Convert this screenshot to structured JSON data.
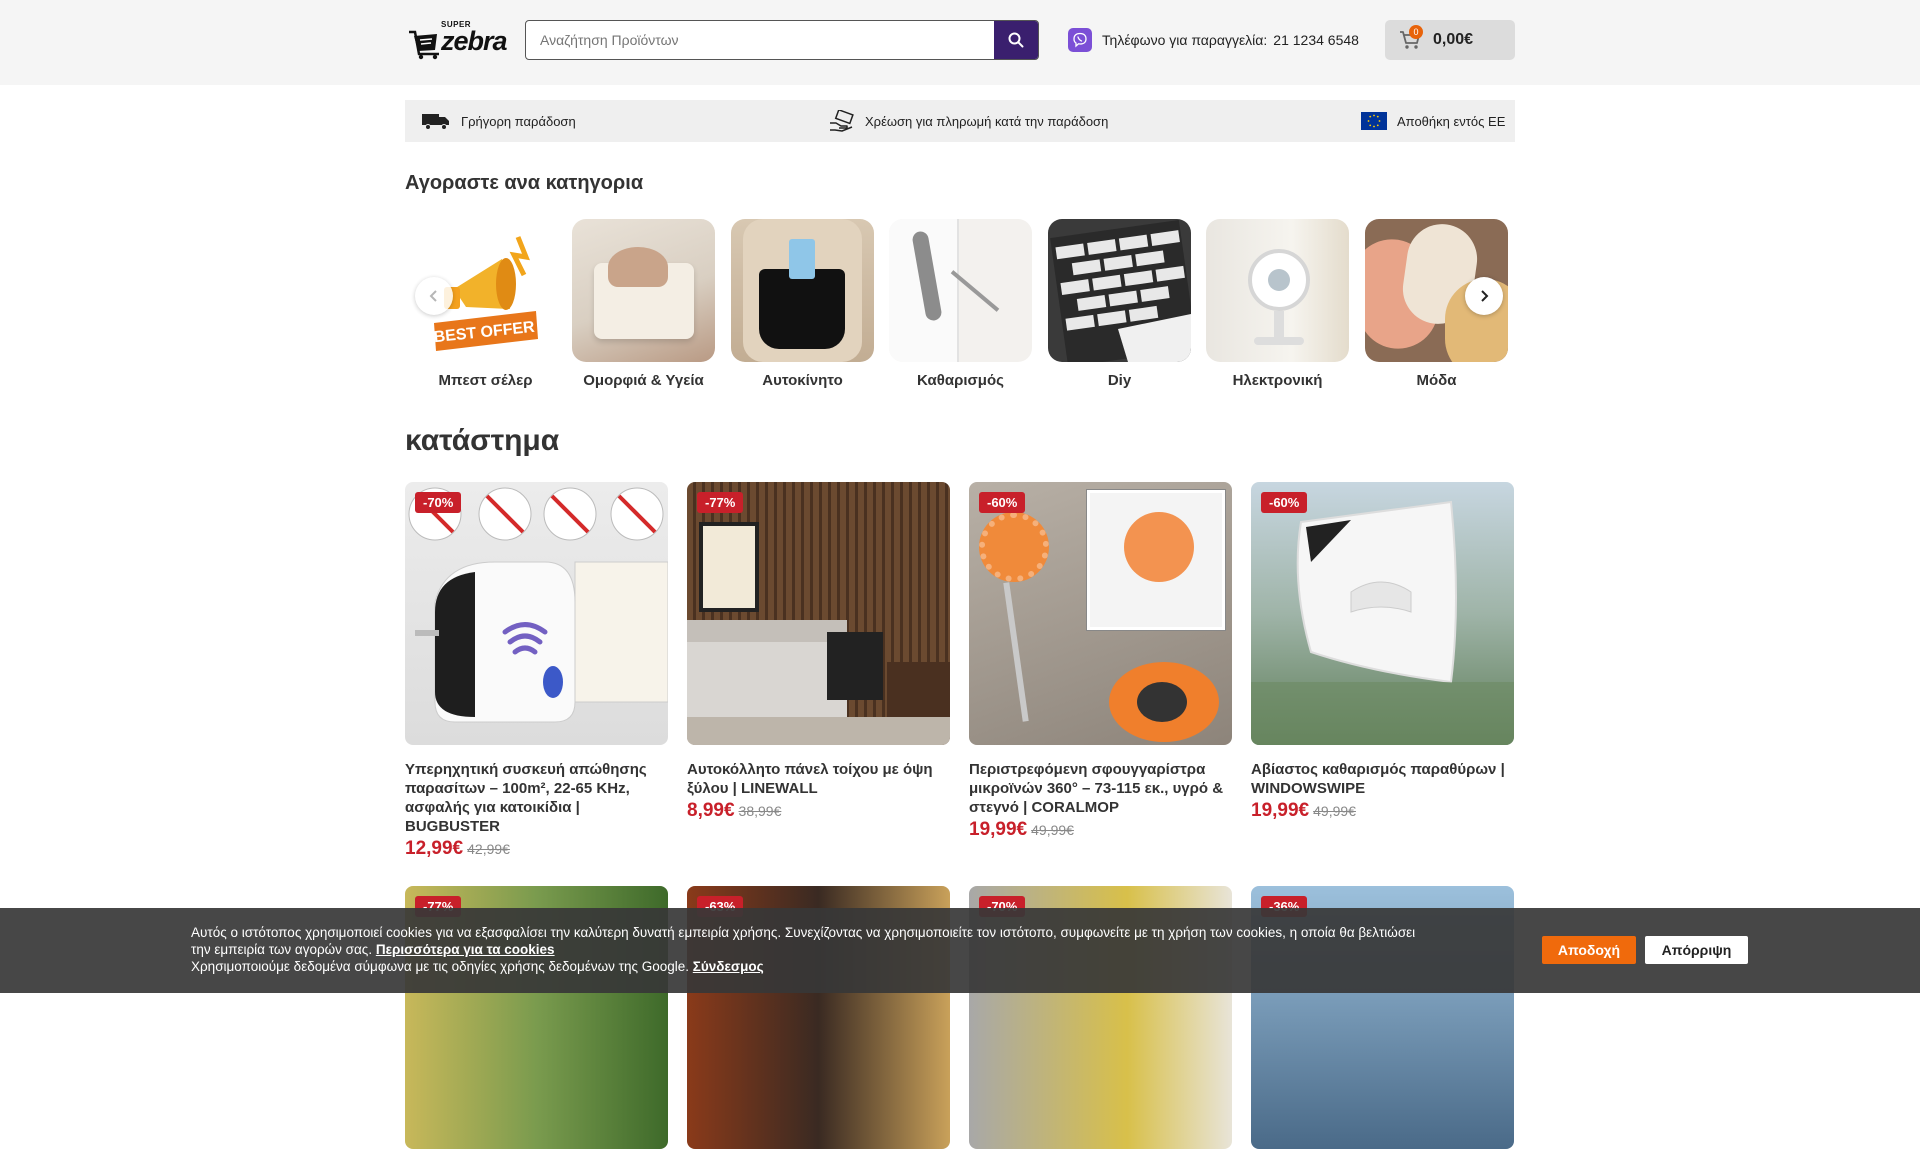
{
  "header": {
    "logo_text_small": "SUPER",
    "logo_text": "zebra",
    "search_placeholder": "Αναζήτηση Προϊόντων",
    "phone_label": "Τηλέφωνο για παραγγελία:",
    "phone_number": "21 1234 6548",
    "cart_count": "0",
    "cart_total": "0,00€"
  },
  "usp": [
    {
      "label": "Γρήγορη παράδοση",
      "icon": "truck-icon"
    },
    {
      "label": "Χρέωση για πληρωμή κατά την παράδοση",
      "icon": "cash-hand-icon"
    },
    {
      "label": "Αποθήκη εντός ΕΕ",
      "icon": "eu-flag-icon"
    }
  ],
  "categories_title": "Αγοραστε ανα κατηγορια",
  "categories": [
    {
      "label": "Μπεστ σέλερ",
      "image": "best-offer-megaphone"
    },
    {
      "label": "Ομορφιά & Υγεία",
      "image": "cosmetic-organizer"
    },
    {
      "label": "Αυτοκίνητο",
      "image": "car-seat-organizer"
    },
    {
      "label": "Καθαρισμός",
      "image": "duster-brush"
    },
    {
      "label": "Diy",
      "image": "wall-tiles"
    },
    {
      "label": "Ηλεκτρονική",
      "image": "desk-fan"
    },
    {
      "label": "Μόδα",
      "image": "wool-socks"
    }
  ],
  "shop_title": "κατάστημα",
  "products": [
    {
      "badge": "-70%",
      "name": "Υπερηχητική συσκευή απώθησης παρασίτων – 100m², 22-65 KHz, ασφαλής για κατοικίδια | BUGBUSTER",
      "price": "12,99€",
      "old_price": "42,99€"
    },
    {
      "badge": "-77%",
      "name": "Αυτοκόλλητο πάνελ τοίχου με όψη ξύλου | LINEWALL",
      "price": "8,99€",
      "old_price": "38,99€"
    },
    {
      "badge": "-60%",
      "name": "Περιστρεφόμενη σφουγγαρίστρα μικροϊνών 360° – 73-115 εκ., υγρό & στεγνό | CORALMOP",
      "price": "19,99€",
      "old_price": "49,99€"
    },
    {
      "badge": "-60%",
      "name": "Αβίαστος καθαρισμός παραθύρων | WINDOWSWIPE",
      "price": "19,99€",
      "old_price": "49,99€"
    },
    {
      "badge": "-77%",
      "name": "",
      "price": "",
      "old_price": ""
    },
    {
      "badge": "-63%",
      "name": "",
      "price": "",
      "old_price": ""
    },
    {
      "badge": "-70%",
      "name": "",
      "price": "",
      "old_price": ""
    },
    {
      "badge": "-36%",
      "name": "",
      "price": "",
      "old_price": ""
    }
  ],
  "cookie": {
    "line1": "Αυτός ο ιστότοπος χρησιμοποιεί cookies για να εξασφαλίσει την καλύτερη δυνατή εμπειρία χρήσης. Συνεχίζοντας να χρησιμοποιείτε τον ιστότοπο, συμφωνείτε με τη χρήση των cookies, η οποία θα βελτιώσει",
    "line2_prefix": "την εμπειρία των αγορών σας.",
    "more_link": "Περισσότερα για τα cookies",
    "line3_prefix": "Χρησιμοποιούμε δεδομένα σύμφωνα με τις οδηγίες χρήσης δεδομένων της Google.",
    "google_link": "Σύνδεσμος",
    "accept": "Αποδοχή",
    "reject": "Απόρριψη"
  },
  "colors": {
    "accent_purple": "#3a1f6e",
    "price_red": "#c8202a",
    "cookie_orange": "#f06a0c"
  }
}
